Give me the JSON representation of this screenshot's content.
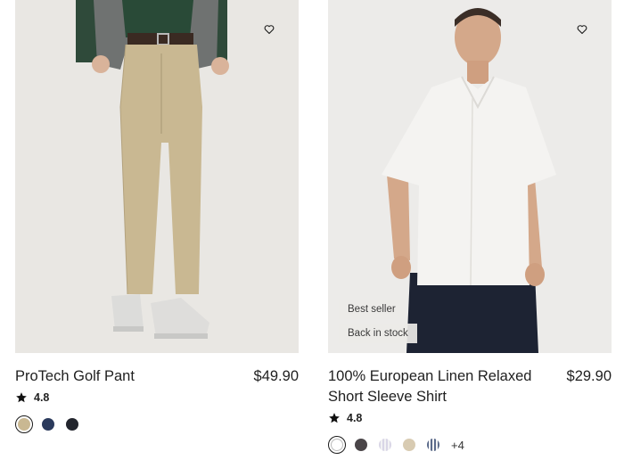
{
  "products": [
    {
      "name": "ProTech Golf Pant",
      "price": "$49.90",
      "rating": "4.8",
      "badges": [],
      "swatches": [
        "#c9b892",
        "#2b3a5c",
        "#22252d"
      ],
      "more": ""
    },
    {
      "name": "100% European Linen Relaxed Short Sleeve Shirt",
      "price": "$29.90",
      "rating": "4.8",
      "badges": [
        "Best seller",
        "Back in stock"
      ],
      "swatches": [
        "#ffffff",
        "#4a4548",
        "#d9d6e6",
        "#d8cbb2",
        "#5b6a8a"
      ],
      "more": "+4"
    }
  ]
}
